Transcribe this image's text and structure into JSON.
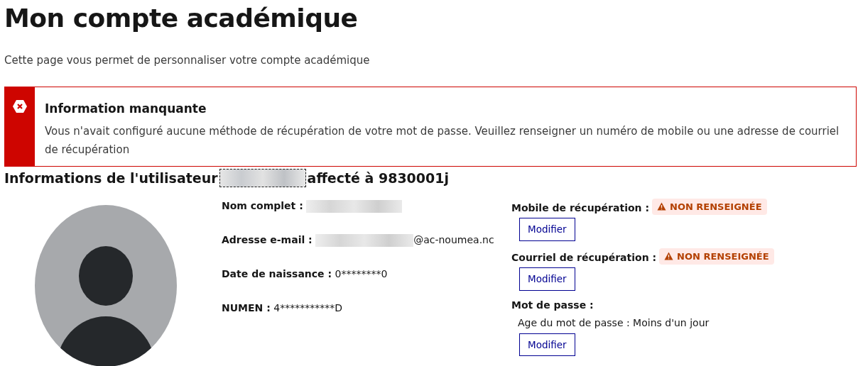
{
  "title": "Mon compte académique",
  "intro": "Cette page vous permet de personnaliser votre compte académique",
  "alert": {
    "kind": "error",
    "title": "Information manquante",
    "message": "Vous n'avait configuré aucune méthode de récupération de votre mot de passe. Veuillez renseigner un numéro de mobile ou une adresse de courriel de récupération"
  },
  "user_heading": {
    "prefix": "Informations de l'utilisateur",
    "suffix": "affecté à 9830001j"
  },
  "fields": [
    {
      "label": "Nom complet :",
      "redacted": true
    },
    {
      "label": "Adresse e-mail :",
      "value": "@ac-noumea.nc",
      "redacted": true
    },
    {
      "label": "Date de naissance :",
      "value": "0********0",
      "redacted": false
    },
    {
      "label": "NUMEN :",
      "value": "4***********D",
      "redacted": false
    }
  ],
  "recovery": [
    {
      "label": "Mobile de récupération :",
      "badge": "NON RENSEIGNÉE",
      "button": "Modifier"
    },
    {
      "label": "Courriel de récupération :",
      "badge": "NON RENSEIGNÉE",
      "button": "Modifier"
    },
    {
      "label": "Mot de passe :",
      "detail": "Age du mot de passe : Moins d'un jour",
      "button": "Modifier"
    }
  ]
}
